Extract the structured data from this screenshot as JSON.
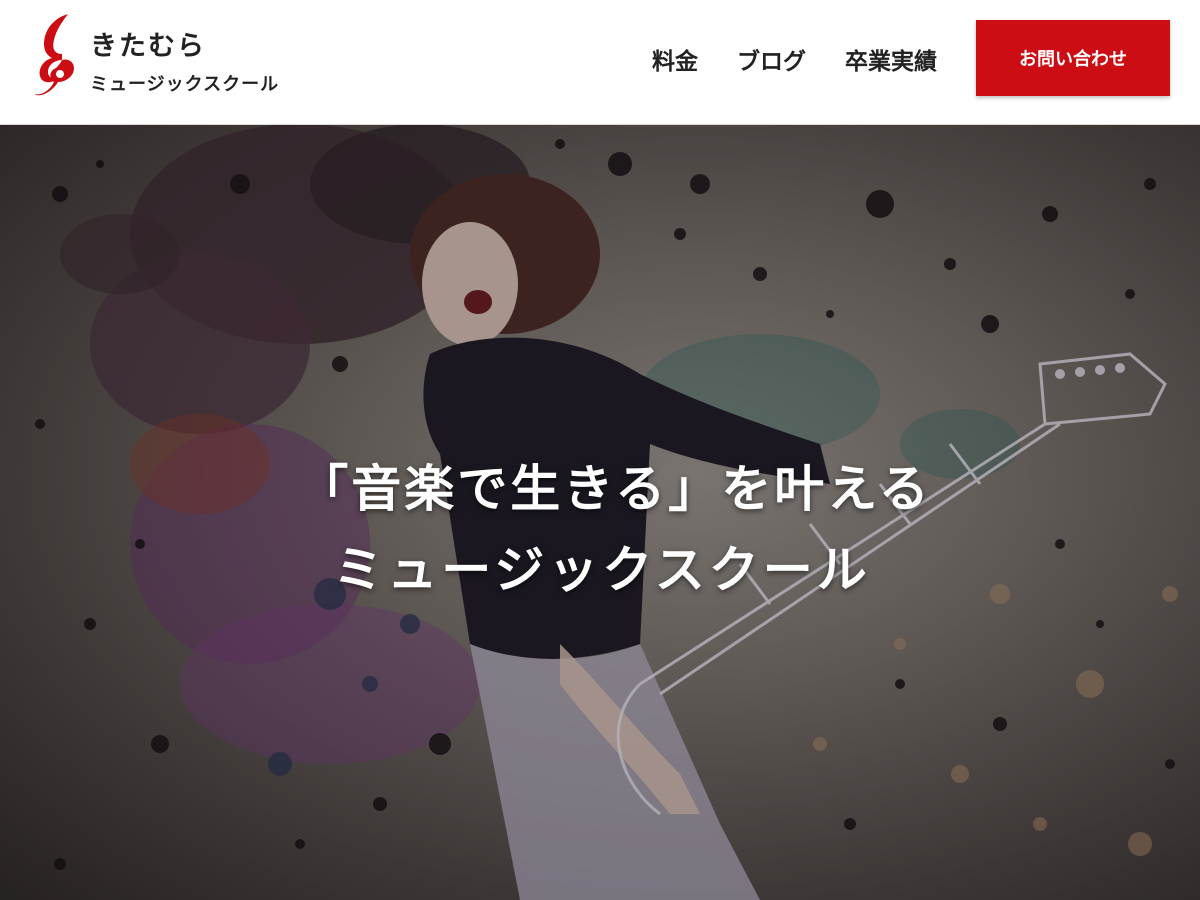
{
  "brand": {
    "name_line1": "きたむら",
    "name_line2": "ミュージックスクール",
    "logo_icon": "music-note-icon",
    "accent_color": "#cc0d13"
  },
  "nav": {
    "items": [
      {
        "label": "料金"
      },
      {
        "label": "ブログ"
      },
      {
        "label": "卒業実績"
      }
    ],
    "cta_label": "お問い合わせ"
  },
  "hero": {
    "headline_line1": "「音楽で生きる」を叶える",
    "headline_line2": "ミュージックスクール",
    "image": "hero-singer-guitar-paint-splash-image"
  }
}
